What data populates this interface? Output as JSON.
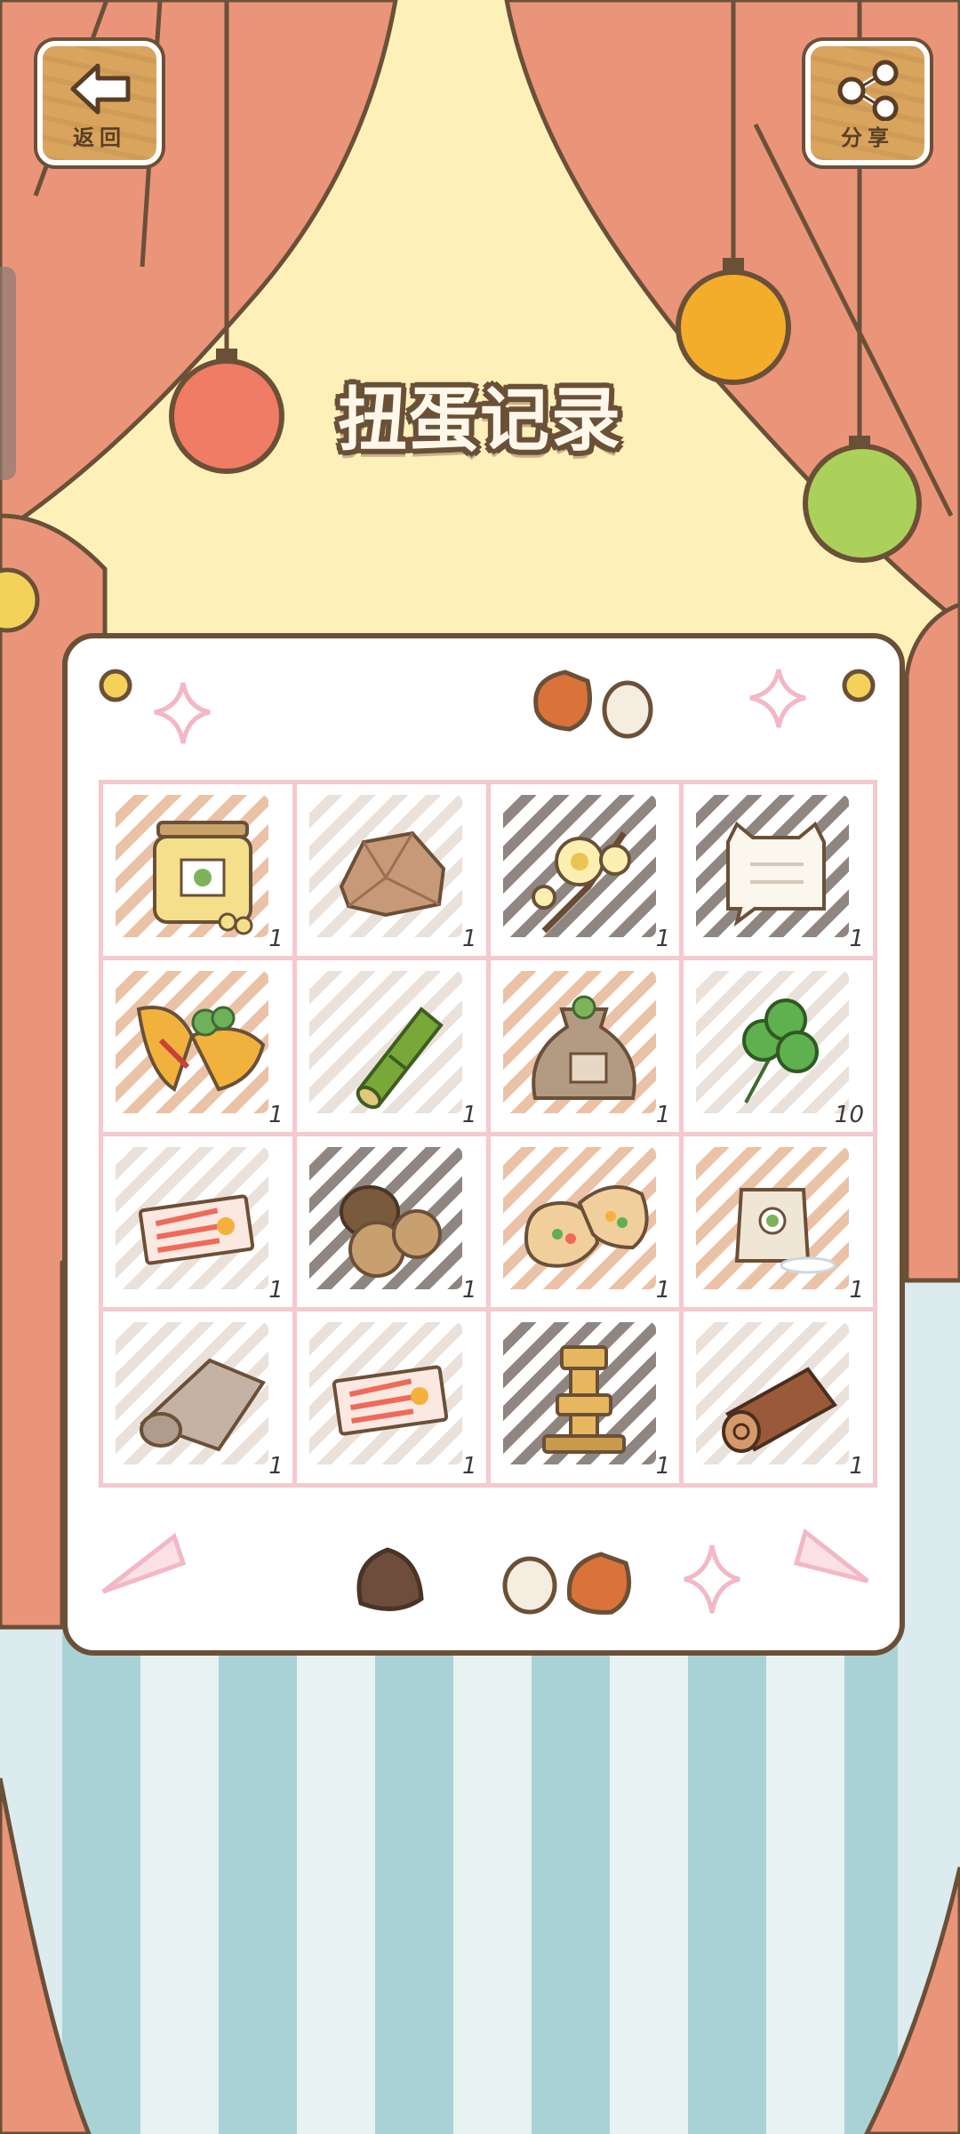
{
  "header": {
    "back_label": "返回",
    "share_label": "分享",
    "title": "扭蛋记录"
  },
  "colors": {
    "curtain": "#ea957a",
    "wall": "#fdf0b8",
    "outline": "#6b5038",
    "grid_border": "#f4c9cf"
  },
  "items": [
    {
      "name": "bean-jar",
      "icon": "jar-icon",
      "count": "1"
    },
    {
      "name": "rock",
      "icon": "rock-icon",
      "count": "1"
    },
    {
      "name": "wintersweet-flower",
      "icon": "flower-branch-icon",
      "count": "1"
    },
    {
      "name": "cat-letter",
      "icon": "cat-note-icon",
      "count": "1"
    },
    {
      "name": "omelette",
      "icon": "omelette-icon",
      "count": "1"
    },
    {
      "name": "bamboo",
      "icon": "bamboo-icon",
      "count": "1"
    },
    {
      "name": "seed-bag",
      "icon": "seed-bag-icon",
      "count": "1"
    },
    {
      "name": "clover",
      "icon": "clover-icon",
      "count": "10"
    },
    {
      "name": "ticket",
      "icon": "ticket-icon",
      "count": "1"
    },
    {
      "name": "chestnuts",
      "icon": "chestnut-icon",
      "count": "1"
    },
    {
      "name": "pita-bread",
      "icon": "pita-icon",
      "count": "1"
    },
    {
      "name": "flour-bag",
      "icon": "flour-bag-icon",
      "count": "1"
    },
    {
      "name": "rolled-cloth",
      "icon": "cloth-roll-icon",
      "count": "1"
    },
    {
      "name": "ticket",
      "icon": "ticket-icon",
      "count": "1"
    },
    {
      "name": "stone-lantern",
      "icon": "stone-stack-icon",
      "count": "1"
    },
    {
      "name": "log",
      "icon": "log-icon",
      "count": "1"
    }
  ]
}
